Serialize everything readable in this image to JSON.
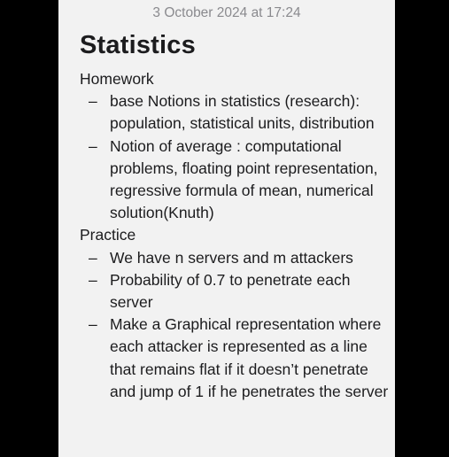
{
  "note": {
    "date": "3 October 2024 at 17:24",
    "title": "Statistics",
    "sections": [
      {
        "heading": "Homework",
        "items": [
          "base Notions in statistics (research): population, statistical units, distribution",
          "Notion of average : computational problems, floating point representation, regressive formula of mean, numerical solution(Knuth)"
        ]
      },
      {
        "heading": "Practice",
        "items": [
          "We have n servers and m attackers",
          "Probability of 0.7 to penetrate each server",
          "Make a Graphical representation where each attacker is represented as a line that remains flat if it doesn’t penetrate and jump of 1 if he penetrates the server"
        ]
      }
    ],
    "bullet_glyph": "–"
  }
}
